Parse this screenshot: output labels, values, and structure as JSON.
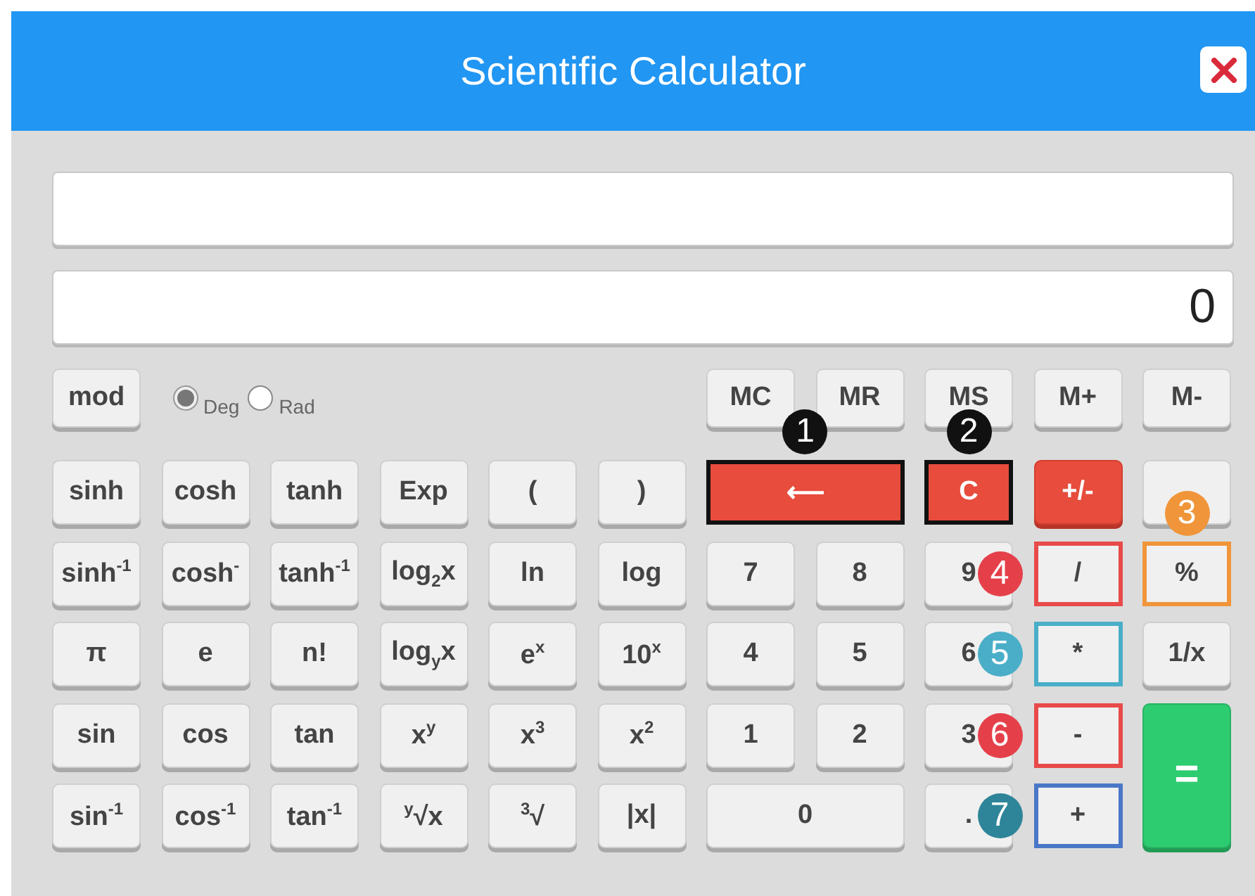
{
  "window": {
    "title": "Scientific Calculator"
  },
  "display": {
    "result": "0"
  },
  "mode_key": {
    "label": "mod"
  },
  "angle_units": [
    {
      "label": "Deg",
      "selected": true
    },
    {
      "label": "Rad",
      "selected": false
    }
  ],
  "memory_keys": [
    {
      "label": "MC"
    },
    {
      "label": "MR"
    },
    {
      "label": "MS"
    },
    {
      "label": "M+"
    },
    {
      "label": "M-"
    }
  ],
  "keys": [
    {
      "label": "sinh",
      "kind": "plain"
    },
    {
      "label": "cosh",
      "kind": "plain"
    },
    {
      "label": "tanh",
      "kind": "plain"
    },
    {
      "label": "Exp",
      "kind": "plain"
    },
    {
      "label": "(",
      "kind": "plain"
    },
    {
      "label": ")",
      "kind": "plain"
    },
    {
      "label": "⟵",
      "kind": "wide-danger",
      "outline": {
        "color": "#111111"
      },
      "badge": {
        "label": "1",
        "color": "#111111",
        "kind": "top"
      }
    },
    {
      "label": "C",
      "kind": "danger",
      "outline": {
        "color": "#111111"
      },
      "badge": {
        "label": "2",
        "color": "#111111",
        "kind": "top"
      }
    },
    {
      "label": "+/-",
      "kind": "danger"
    },
    {
      "kind": "plain"
    },
    {
      "label": "sinh$^{-1}$",
      "kind": "plain"
    },
    {
      "label": "cosh$^{-}$",
      "kind": "plain"
    },
    {
      "label": "tanh$^{-1}$",
      "kind": "plain"
    },
    {
      "label": "log$_{2}$x",
      "kind": "plain"
    },
    {
      "label": "ln",
      "kind": "plain"
    },
    {
      "label": "log",
      "kind": "plain"
    },
    {
      "label": "7",
      "kind": "plain"
    },
    {
      "label": "8",
      "kind": "plain"
    },
    {
      "label": "9",
      "kind": "plain"
    },
    {
      "label": "/",
      "kind": "plain",
      "outline": {
        "color": "#e84a4a"
      },
      "badge": {
        "label": "4",
        "color": "#e5404a",
        "kind": "left"
      }
    },
    {
      "label": "%",
      "kind": "plain",
      "outline": {
        "color": "#f0953a"
      },
      "badge": {
        "label": "3",
        "color": "#f0953a",
        "kind": "top"
      }
    },
    {
      "label": "π",
      "kind": "plain"
    },
    {
      "label": "e",
      "kind": "plain"
    },
    {
      "label": "n!",
      "kind": "plain"
    },
    {
      "label": "log$_{y}$x",
      "kind": "plain"
    },
    {
      "label": "e$^{x}$",
      "kind": "plain"
    },
    {
      "label": "10$^{x}$",
      "kind": "plain"
    },
    {
      "label": "4",
      "kind": "plain"
    },
    {
      "label": "5",
      "kind": "plain"
    },
    {
      "label": "6",
      "kind": "plain"
    },
    {
      "label": "*",
      "kind": "plain",
      "outline": {
        "color": "#4aaec8"
      },
      "badge": {
        "label": "5",
        "color": "#4aaec8",
        "kind": "left"
      }
    },
    {
      "label": "1/x",
      "kind": "plain"
    },
    {
      "label": "sin",
      "kind": "plain"
    },
    {
      "label": "cos",
      "kind": "plain"
    },
    {
      "label": "tan",
      "kind": "plain"
    },
    {
      "label": "x$^{y}$",
      "kind": "plain"
    },
    {
      "label": "x$^{3}$",
      "kind": "plain"
    },
    {
      "label": "x$^{2}$",
      "kind": "plain"
    },
    {
      "label": "1",
      "kind": "plain"
    },
    {
      "label": "2",
      "kind": "plain"
    },
    {
      "label": "3",
      "kind": "plain"
    },
    {
      "label": "-",
      "kind": "plain",
      "outline": {
        "color": "#e84a4a"
      },
      "badge": {
        "label": "6",
        "color": "#e5404a",
        "kind": "left"
      }
    },
    {
      "label": "=",
      "kind": "equals"
    },
    {
      "label": "sin$^{-1}$",
      "kind": "plain"
    },
    {
      "label": "cos$^{-1}$",
      "kind": "plain"
    },
    {
      "label": "tan$^{-1}$",
      "kind": "plain"
    },
    {
      "label": "$^{y}$√x",
      "kind": "plain"
    },
    {
      "label": "$^{3}$√",
      "kind": "plain"
    },
    {
      "label": "|x|",
      "kind": "plain"
    },
    {
      "label": "0",
      "kind": "wide"
    },
    {
      "label": ".",
      "kind": "plain"
    },
    {
      "label": "+",
      "kind": "plain",
      "outline": {
        "color": "#4a77c8"
      },
      "badge": {
        "label": "7",
        "color": "#2e8599",
        "kind": "left"
      }
    }
  ]
}
